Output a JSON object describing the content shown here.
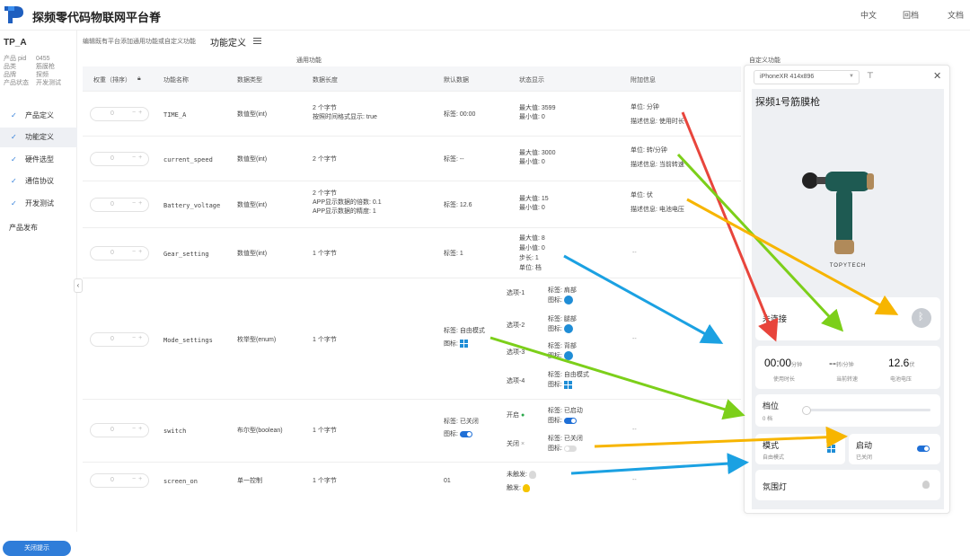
{
  "header": {
    "brand": "探频零代码物联网平台脊",
    "nav": [
      "中文",
      "回档",
      "文档"
    ]
  },
  "sidebar": {
    "product_title": "TP_A",
    "meta": [
      {
        "k": "产品 pid",
        "v": "0455"
      },
      {
        "k": "品类",
        "v": "筋膜枪"
      },
      {
        "k": "品牌",
        "v": "探频"
      },
      {
        "k": "产品状态",
        "v": "开发测试"
      }
    ],
    "menu": [
      "产品定义",
      "功能定义",
      "硬件选型",
      "通信协议",
      "开发测试"
    ],
    "publish": "产品发布",
    "close_btn": "关闭提示",
    "collapse": "‹"
  },
  "main": {
    "breadcrumb": "编辑既有平台添加通用功能或自定义功能",
    "title": "功能定义",
    "section_general": "通用功能",
    "section_custom": "自定义功能",
    "columns": [
      "权重（排序）",
      "功能名称",
      "数据类型",
      "数据长度",
      "默认数据",
      "状态显示",
      "附加信息"
    ],
    "rows": [
      {
        "weight": "0",
        "name": "TIME_A",
        "type": "数值型(int)",
        "length": [
          "2 个字节",
          "按照时间格式显示: true"
        ],
        "default": "标签: 00:00",
        "status": [
          "最大值: 3599",
          "最小值: 0"
        ],
        "extra": [
          "单位: 分钟",
          "描述信息: 使用时长"
        ]
      },
      {
        "weight": "0",
        "name": "current_speed",
        "type": "数值型(int)",
        "length": [
          "2 个字节"
        ],
        "default": "标签: --",
        "status": [
          "最大值: 3000",
          "最小值: 0"
        ],
        "extra": [
          "单位: 转/分钟",
          "描述信息: 当前转速"
        ]
      },
      {
        "weight": "0",
        "name": "Battery_voltage",
        "type": "数值型(int)",
        "length": [
          "2 个字节",
          "APP显示数据的倍数: 0.1",
          "APP显示数据的精度: 1"
        ],
        "default": "标签: 12.6",
        "status": [
          "最大值: 15",
          "最小值: 0"
        ],
        "extra": [
          "单位: 伏",
          "描述信息: 电池电压"
        ]
      },
      {
        "weight": "0",
        "name": "Gear_setting",
        "type": "数值型(int)",
        "length": [
          "1 个字节"
        ],
        "default": "标签: 1",
        "status": [
          "最大值: 8",
          "最小值: 0",
          "步长: 1",
          "单位: 档"
        ],
        "extra": [
          "--"
        ]
      },
      {
        "weight": "0",
        "name": "Mode_settings",
        "type": "枚举型(enum)",
        "length": [
          "1 个字节"
        ],
        "default": "标签: 自由模式",
        "default_icon": "图标:",
        "options": [
          {
            "k": "选项-1",
            "label": "标签: 肩部",
            "icon": "图标:"
          },
          {
            "k": "选项-2",
            "label": "标签: 腿部",
            "icon": "图标:"
          },
          {
            "k": "选项-3",
            "label": "标签: 背部",
            "icon": "图标:"
          },
          {
            "k": "选项-4",
            "label": "标签: 自由模式",
            "icon": "图标:"
          }
        ],
        "extra": [
          "--"
        ]
      },
      {
        "weight": "0",
        "name": "switch",
        "type": "布尔型(boolean)",
        "length": [
          "1 个字节"
        ],
        "default": "标签: 已关闭",
        "default_icon": "图标:",
        "on": {
          "k": "开启",
          "label": "标签: 已启动",
          "icon": "图标:"
        },
        "off": {
          "k": "关闭",
          "label": "标签: 已关闭",
          "icon": "图标:"
        },
        "extra": [
          "--"
        ]
      },
      {
        "weight": "0",
        "name": "screen_on",
        "type": "单一控制",
        "length": [
          "1 个字节"
        ],
        "default": "01",
        "trigger": [
          "未触发:",
          "触发:"
        ],
        "extra": [
          "--"
        ]
      }
    ]
  },
  "phone": {
    "device": "iPhoneXR 414x896",
    "name": "探频1号筋膜枪",
    "brand": "TOPYTECH",
    "connect": "未连接",
    "stats": [
      {
        "value": "00:00",
        "unit": "分钟",
        "label": "使用时长"
      },
      {
        "value": "--",
        "unit": "转/分钟",
        "label": "当前转速"
      },
      {
        "value": "12.6",
        "unit": "伏",
        "label": "电池电压"
      }
    ],
    "gear_title": "档位",
    "gear_value": "0 档",
    "mode_title": "模式",
    "mode_value": "自由模式",
    "power_title": "启动",
    "power_value": "已关闭",
    "light_title": "氛围灯",
    "colors": {
      "accent": "#2f7dd9",
      "arrow_red": "#e8453c",
      "arrow_green": "#7ccf1a",
      "arrow_yellow": "#f7b500",
      "arrow_blue": "#1ba1e2"
    }
  }
}
